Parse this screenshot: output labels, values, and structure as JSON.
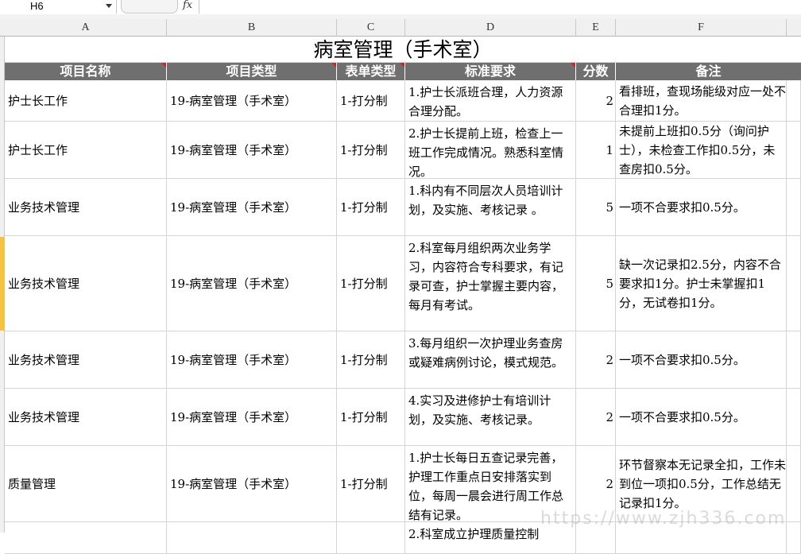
{
  "formula_bar": {
    "name_box": "H6",
    "fx": "fx",
    "content": ""
  },
  "columns": [
    "A",
    "B",
    "C",
    "D",
    "E",
    "F"
  ],
  "sheet_title": "病室管理（手术室）",
  "headers": [
    "项目名称",
    "项目类型",
    "表单类型",
    "标准要求",
    "分数",
    "备注"
  ],
  "rows": [
    {
      "name": "护士长工作",
      "type": "19-病室管理（手术室）",
      "form": "1-打分制",
      "req": "1.护士长派班合理，人力资源合理分配。",
      "score": "2",
      "note": "看排班，查现场能级对应一处不合理扣1分。"
    },
    {
      "name": "护士长工作",
      "type": "19-病室管理（手术室）",
      "form": "1-打分制",
      "req": "2.护士长提前上班，检查上一班工作完成情况。熟悉科室情况。",
      "score": "1",
      "note": "未提前上班扣0.5分（询问护士），未检查工作扣0.5分，未查房扣0.5分。"
    },
    {
      "name": "业务技术管理",
      "type": "19-病室管理（手术室）",
      "form": "1-打分制",
      "req": "1.科内有不同层次人员培训计划，及实施、考核记录 。",
      "score": "5",
      "note": "一项不合要求扣0.5分。"
    },
    {
      "name": "业务技术管理",
      "type": "19-病室管理（手术室）",
      "form": "1-打分制",
      "req": "2.科室每月组织两次业务学习，内容符合专科要求，有记录可查，护士掌握主要内容，每月有考试。",
      "score": "5",
      "note": "缺一次记录扣2.5分，内容不合要求扣1分。护士未掌握扣1分，无试卷扣1分。"
    },
    {
      "name": "业务技术管理",
      "type": "19-病室管理（手术室）",
      "form": "1-打分制",
      "req": "3.每月组织一次护理业务查房或疑难病例讨论，模式规范。",
      "score": "2",
      "note": "一项不合要求扣0.5分。"
    },
    {
      "name": "业务技术管理",
      "type": "19-病室管理（手术室）",
      "form": "1-打分制",
      "req": "4.实习及进修护士有培训计划，及实施、考核记录。",
      "score": "2",
      "note": "一项不合要求扣0.5分。"
    },
    {
      "name": "质量管理",
      "type": "19-病室管理（手术室）",
      "form": "1-打分制",
      "req": "1.护士长每日五查记录完善，护理工作重点日安排落实到位，每周一晨会进行周工作总结有记录。",
      "score": "2",
      "note": "环节督察本无记录全扣，工作未到位一项扣0.5分，工作总结无记录扣1分。"
    },
    {
      "name": "",
      "type": "",
      "form": "",
      "req": "2.科室成立护理质量控制",
      "score": "",
      "note": ""
    }
  ],
  "watermark": "https://www.zjh336.com"
}
